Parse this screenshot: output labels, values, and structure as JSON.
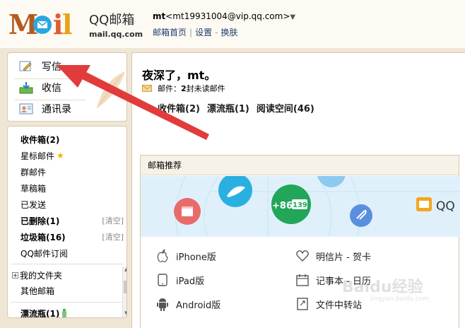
{
  "header": {
    "brand": "QQ邮箱",
    "domain": "mail.qq.com",
    "account_name": "mt",
    "account_email": "<mt19931004@vip.qq.com>",
    "links": [
      "邮箱首页",
      "设置",
      "换肤"
    ]
  },
  "left_top": {
    "items": [
      {
        "label": "写信",
        "icon": "pencil-icon"
      },
      {
        "label": "收信",
        "icon": "inbox-download-icon"
      },
      {
        "label": "通讯录",
        "icon": "contacts-icon"
      }
    ]
  },
  "folders": {
    "items": [
      {
        "label": "收件箱(2)",
        "bold": true
      },
      {
        "label": "星标邮件",
        "star": true
      },
      {
        "label": "群邮件"
      },
      {
        "label": "草稿箱"
      },
      {
        "label": "已发送"
      },
      {
        "label": "已删除(1)",
        "bold": true,
        "action": "[清空]"
      },
      {
        "label": "垃圾箱(16)",
        "bold": true,
        "action": "[清空]"
      },
      {
        "label": "QQ邮件订阅"
      }
    ],
    "my_folders": "我的文件夹",
    "other_mail": "其他邮箱",
    "drift_bottle": "漂流瓶(1)"
  },
  "main": {
    "greeting": "夜深了，mt。",
    "mail_prefix": "邮件：",
    "mail_count": "2",
    "mail_suffix": " 封未读邮件",
    "quick_links": [
      "收件箱(2)",
      "漂流瓶(1)",
      "阅读空间(46)"
    ]
  },
  "recommend": {
    "title": "邮箱推荐",
    "banner_text": "+86",
    "banner_num": "139",
    "banner_right": "QQ",
    "links": [
      {
        "label": "iPhone版",
        "icon": "apple-icon"
      },
      {
        "label": "明信片 - 贺卡",
        "icon": "heart-icon"
      },
      {
        "label": "iPad版",
        "icon": "ipad-icon"
      },
      {
        "label": "记事本 - 日历",
        "icon": "calendar-icon"
      },
      {
        "label": "Android版",
        "icon": "android-icon"
      },
      {
        "label": "文件中转站",
        "icon": "file-transfer-icon"
      }
    ]
  },
  "watermark": {
    "text": "Baidu经验",
    "sub": "jingyan.baidu.com"
  },
  "colors": {
    "arrow": "#e23b3b",
    "accent": "#e8a040",
    "banner_green": "#21a65a",
    "banner_blue": "#2ab0e0"
  }
}
